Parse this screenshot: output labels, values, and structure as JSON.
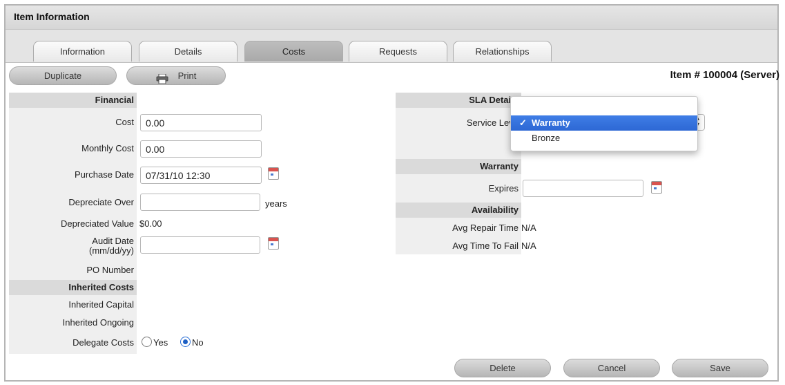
{
  "window": {
    "title": "Item Information"
  },
  "tabs": [
    {
      "label": "Information",
      "active": false
    },
    {
      "label": "Details",
      "active": false
    },
    {
      "label": "Costs",
      "active": true
    },
    {
      "label": "Requests",
      "active": false
    },
    {
      "label": "Relationships",
      "active": false
    }
  ],
  "toolbar": {
    "duplicate_label": "Duplicate",
    "print_label": "Print",
    "item_number": "Item # 100004 (Server)"
  },
  "financial": {
    "heading": "Financial",
    "cost_label": "Cost",
    "cost_value": "0.00",
    "monthly_cost_label": "Monthly Cost",
    "monthly_cost_value": "0.00",
    "purchase_date_label": "Purchase Date",
    "purchase_date_value": "07/31/10 12:30",
    "depreciate_over_label": "Depreciate Over",
    "depreciate_over_value": "",
    "years_label": "years",
    "depreciated_value_label": "Depreciated Value",
    "depreciated_value": "$0.00",
    "audit_date_label_1": "Audit Date",
    "audit_date_label_2": "(mm/dd/yy)",
    "audit_date_value": "",
    "po_number_label": "PO Number"
  },
  "inherited": {
    "heading": "Inherited Costs",
    "capital_label": "Inherited Capital",
    "ongoing_label": "Inherited Ongoing",
    "delegate_label": "Delegate Costs",
    "yes_label": "Yes",
    "no_label": "No",
    "selected": "No"
  },
  "sla": {
    "heading": "SLA Details",
    "service_level_label": "Service Leve",
    "options": [
      "Warranty",
      "Bronze"
    ],
    "selected": "Warranty",
    "check_glyph": "✓"
  },
  "warranty": {
    "heading": "Warranty",
    "expires_label": "Expires",
    "expires_value": ""
  },
  "availability": {
    "heading": "Availability",
    "repair_label": "Avg Repair Time",
    "repair_value": "N/A",
    "fail_label": "Avg Time To Fail",
    "fail_value": "N/A"
  },
  "footer": {
    "delete_label": "Delete",
    "cancel_label": "Cancel",
    "save_label": "Save"
  },
  "colors": {
    "accent": "#2d68d4",
    "section_header": "#dadada",
    "tab_active": "#b3b3b3"
  }
}
